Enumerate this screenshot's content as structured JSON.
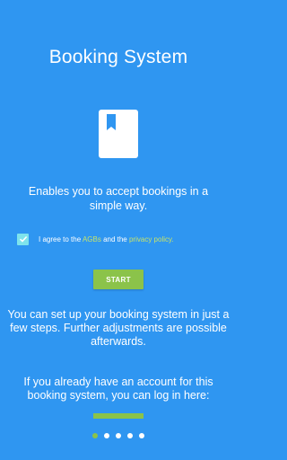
{
  "screen": {
    "title": "Booking System",
    "icon": "book-bookmark-icon",
    "tagline": "Enables you to accept bookings in a simple way."
  },
  "agreement": {
    "checked": true,
    "prefix": "I agree to the ",
    "agb_link": "AGBs",
    "middle": " and the ",
    "privacy_link": "privacy policy."
  },
  "start_button": {
    "label": "START"
  },
  "setup_text": "You can set up your booking system in just a few steps. Further adjustments are possible afterwards.",
  "login_text": "If you already have an account for this booking system, you can log in here:",
  "pager": {
    "count": 5,
    "active_index": 0
  },
  "colors": {
    "background": "#2f96f1",
    "accent_green": "#8bc34a",
    "checkbox": "#7ee3ec",
    "link": "#c6e36a"
  }
}
